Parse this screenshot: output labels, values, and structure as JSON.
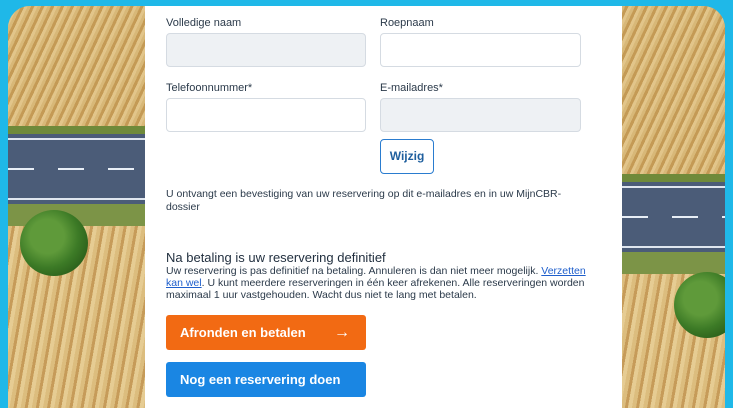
{
  "form": {
    "full_name_label": "Volledige naam",
    "nickname_label": "Roepnaam",
    "phone_label": "Telefoonnummer*",
    "email_label": "E-mailadres*",
    "full_name_value": "",
    "nickname_value": "",
    "phone_value": "",
    "email_value": "",
    "change_button": "Wijzig"
  },
  "confirmation_text": "U ontvangt een bevestiging van uw reservering op dit e-mailadres en in uw MijnCBR-dossier",
  "payment": {
    "heading": "Na betaling is uw reservering definitief",
    "text_before_link": "Uw reservering is pas definitief na betaling. Annuleren is dan niet meer mogelijk. ",
    "link_text": "Verzetten kan wel",
    "text_after_link": ". U kunt meerdere reserveringen in één keer afrekenen. Alle reserveringen worden maximaal 1 uur vastgehouden. Wacht dus niet te lang met betalen."
  },
  "buttons": {
    "pay_label": "Afronden en betalen",
    "pay_icon": "arrow-right-icon",
    "new_reservation_label": "Nog een reservering doen"
  },
  "colors": {
    "background": "#1fb8e8",
    "primary_orange": "#f26a13",
    "primary_blue": "#1a86e3",
    "link": "#1f5fcc"
  }
}
